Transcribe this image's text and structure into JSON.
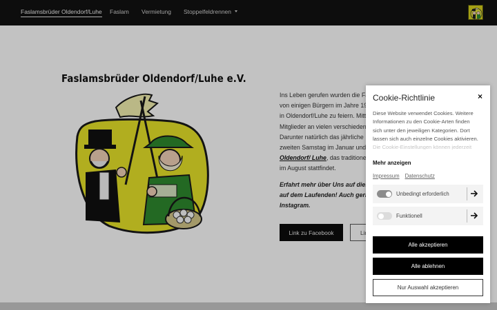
{
  "nav": {
    "items": [
      {
        "label": "Faslamsbrüder Oldendorf/Luhe",
        "active": true
      },
      {
        "label": "Faslam",
        "active": false
      },
      {
        "label": "Vermietung",
        "active": false
      },
      {
        "label": "Stoppelfeldrennen",
        "active": false,
        "has_dropdown": true
      }
    ]
  },
  "main": {
    "emblem_title": "Faslamsbrüder Oldendorf/Luhe e.V.",
    "body_lines": [
      "Ins Leben gerufen wurden die Fa",
      "von einigen Bürgern im Jahre 19",
      "in Oldendorf/Luhe zu feiern. Mitt",
      "Mitglieder an vielen verschieden",
      "Darunter natürlich das jährliche",
      "zweiten Samstag im Januar und"
    ],
    "link_text": "Oldendorf/ Luhe",
    "link_suffix": ", das traditionel",
    "last_line": "im August stattfindet.",
    "italic_lines": [
      "Erfahrt mehr über Uns auf diese",
      "auf dem Laufenden! Auch gern",
      "Instagram."
    ],
    "button_facebook": "Link zu Facebook",
    "button_second": "Lin"
  },
  "cookie": {
    "title": "Cookie-Richtlinie",
    "close_symbol": "×",
    "description_lines": [
      "Diese Website verwendet Cookies. Weitere",
      "Informationen zu den Cookie-Arten finden",
      "sich unter den jeweiligen Kategorien. Dort",
      "lassen sich auch einzelne Cookies aktivieren.",
      "Die Cookie-Einstellungen können jederzeit"
    ],
    "show_more": "Mehr anzeigen",
    "links": [
      "Impressum",
      "Datenschutz"
    ],
    "categories": [
      {
        "label": "Unbedingt erforderlich",
        "enabled": true
      },
      {
        "label": "Funktionell",
        "enabled": false
      }
    ],
    "buttons": {
      "accept_all": "Alle akzeptieren",
      "reject_all": "Alle ablehnen",
      "accept_selection": "Nur Auswahl akzeptieren"
    }
  },
  "colors": {
    "nav_background": "#121212",
    "overlay": "rgba(0,0,0,0.24)",
    "toggle_on": "#8c8c8c",
    "toggle_off": "#dcdcdc",
    "emblem_yellow": "#e8e41a",
    "emblem_green": "#2e8b2e"
  }
}
